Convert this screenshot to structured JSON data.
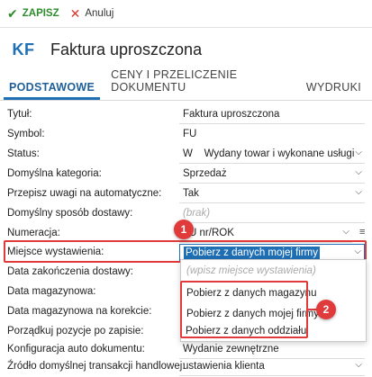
{
  "toolbar": {
    "save_label": "ZAPISZ",
    "cancel_label": "Anuluj"
  },
  "header": {
    "badge": "KF",
    "title": "Faktura uproszczona"
  },
  "tabs": [
    {
      "label": "PODSTAWOWE",
      "active": true
    },
    {
      "label": "CENY I PRZELICZENIE DOKUMENTU"
    },
    {
      "label": "WYDRUKI"
    }
  ],
  "form": {
    "tytul": {
      "label": "Tytuł:",
      "value": "Faktura uproszczona"
    },
    "symbol": {
      "label": "Symbol:",
      "value": "FU"
    },
    "status": {
      "label": "Status:",
      "code": "W",
      "value": "Wydany towar i wykonane usługi"
    },
    "kategoria": {
      "label": "Domyślna kategoria:",
      "value": "Sprzedaż"
    },
    "uwagi": {
      "label": "Przepisz uwagi na automatyczne:",
      "value": "Tak"
    },
    "dostawa": {
      "label": "Domyślny sposób dostawy:",
      "placeholder": "(brak)"
    },
    "numeracja": {
      "label": "Numeracja:",
      "value": "FU nr/ROK"
    },
    "miejsce": {
      "label": "Miejsce wystawienia:",
      "value": "Pobierz z danych mojej firmy"
    },
    "data_dostawy": {
      "label": "Data zakończenia dostawy:"
    },
    "data_mag": {
      "label": "Data magazynowa:"
    },
    "data_mag_kor": {
      "label": "Data magazynowa na korekcie:"
    },
    "porzadkuj": {
      "label": "Porządkuj pozycje po zapisie:"
    },
    "konfig": {
      "label": "Konfiguracja auto dokumentu:",
      "value": "Wydanie zewnętrzne"
    },
    "zrodlo": {
      "label": "Źródło domyślnej transakcji handlowej:",
      "value": "ustawienia klienta"
    }
  },
  "dropdown": {
    "placeholder": "(wpisz miejsce wystawienia)",
    "options": [
      "Pobierz z danych magazynu",
      "Pobierz z danych mojej firmy",
      "Pobierz z danych oddziału"
    ]
  },
  "annotations": {
    "step1": "1",
    "step2": "2"
  },
  "icons": {
    "save": "check-icon",
    "cancel": "close-icon",
    "chevron": "chevron-down-icon",
    "menu": "menu-icon"
  },
  "colors": {
    "accent": "#1f6fb5",
    "save": "#2e8b2e",
    "annotation": "#e03a3a"
  }
}
